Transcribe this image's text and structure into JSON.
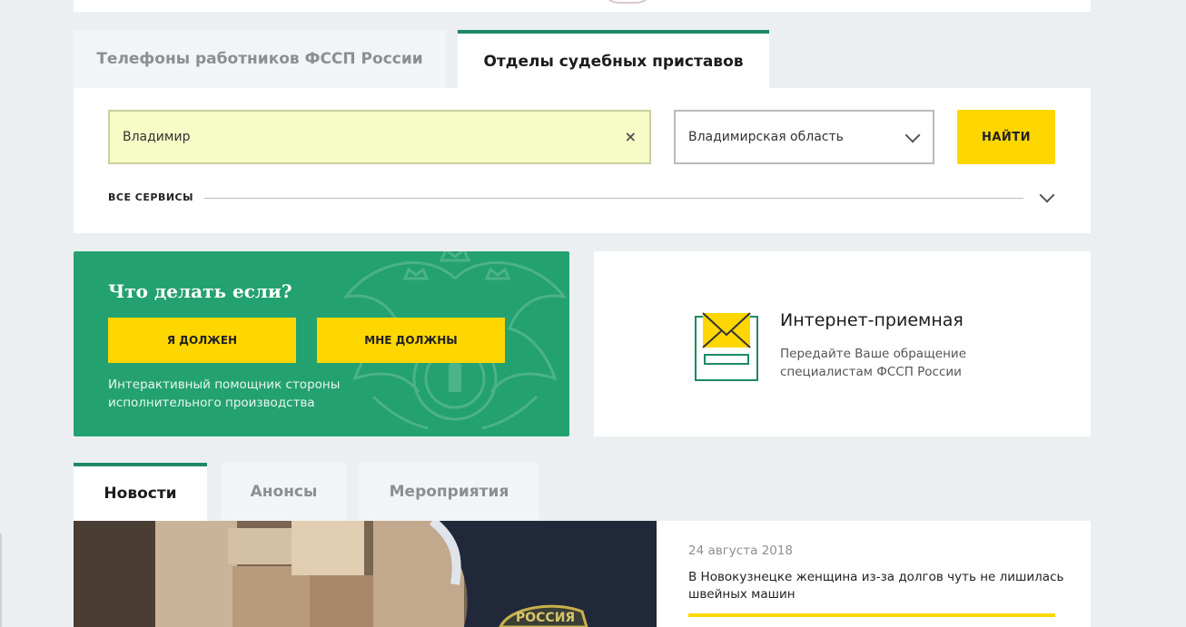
{
  "search_tabs": {
    "phones": "Телефоны работников ФССП России",
    "departments": "Отделы судебных приставов"
  },
  "search": {
    "city_value": "Владимир",
    "clear_symbol": "×",
    "region_value": "Владимирская область",
    "find_label": "НАЙТИ",
    "all_services_label": "ВСЕ СЕРВИСЫ"
  },
  "helper": {
    "title": "Что делать если?",
    "i_owe_label": "Я ДОЛЖЕН",
    "owed_to_me_label": "МНЕ ДОЛЖНЫ",
    "description": "Интерактивный помощник стороны исполнительного производства"
  },
  "reception": {
    "icon": "envelope-icon",
    "title": "Интернет-приемная",
    "description": "Передайте Ваше обращение специалистам ФССП России"
  },
  "news_tabs": {
    "news": "Новости",
    "announcements": "Анонсы",
    "events": "Мероприятия"
  },
  "news": {
    "date": "24 августа 2018",
    "headline": "В Новокузнецке женщина из-за долгов чуть не лишилась швейных машин",
    "photo_patch_text": "РОССИЯ"
  },
  "colors": {
    "accent_green": "#1d8a63",
    "card_green": "#24a170",
    "button_yellow": "#ffd700",
    "input_highlight": "#f7fbc6"
  }
}
